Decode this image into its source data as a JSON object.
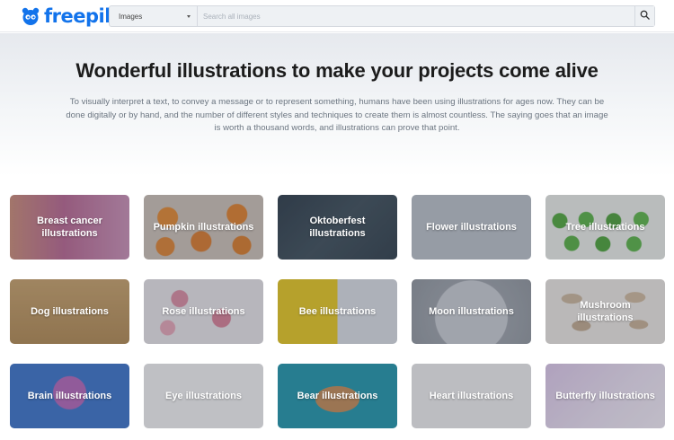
{
  "header": {
    "logo_text": "freepik",
    "search": {
      "category": "Images",
      "placeholder": "Search all images",
      "value": ""
    }
  },
  "hero": {
    "title": "Wonderful illustrations to make your projects come alive",
    "description": "To visually interpret a text, to convey a message or to represent something, humans have been using illustrations for ages now. They can be done digitally or by hand, and the number of different styles and techniques to create them is almost countless. The saying goes that an image is worth a thousand words, and illustrations can prove that point."
  },
  "categories": [
    {
      "label": "Breast cancer illustrations"
    },
    {
      "label": "Pumpkin illustrations"
    },
    {
      "label": "Oktoberfest illustrations"
    },
    {
      "label": "Flower illustrations"
    },
    {
      "label": "Tree illustrations"
    },
    {
      "label": "Dog illustrations"
    },
    {
      "label": "Rose illustrations"
    },
    {
      "label": "Bee illustrations"
    },
    {
      "label": "Moon illustrations"
    },
    {
      "label": "Mushroom illustrations"
    },
    {
      "label": "Brain illustrations"
    },
    {
      "label": "Eye illustrations"
    },
    {
      "label": "Bear illustrations"
    },
    {
      "label": "Heart illustrations"
    },
    {
      "label": "Butterfly illustrations"
    }
  ],
  "colors": {
    "brand": "#1273eb",
    "title": "#1c1c1c",
    "body_text": "#6b7580"
  },
  "icons": {
    "logo": "freepik-mascot-icon",
    "search": "magnifier-icon",
    "dropdown": "chevron-down-icon"
  }
}
